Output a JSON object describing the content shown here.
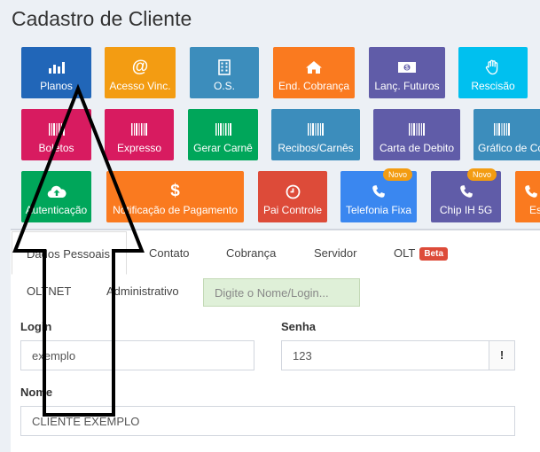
{
  "page": {
    "title": "Cadastro de Cliente"
  },
  "tiles_row1": [
    {
      "label": "Planos",
      "icon": "bar-chart-icon",
      "color": "#2166b8"
    },
    {
      "label": "Acesso Vinc.",
      "icon": "at-icon",
      "color": "#f39c12"
    },
    {
      "label": "O.S.",
      "icon": "building-icon",
      "color": "#3c8dbc"
    },
    {
      "label": "End. Cobrança",
      "icon": "home-icon",
      "color": "#fa7a1f"
    },
    {
      "label": "Lanç. Futuros",
      "icon": "money-icon",
      "color": "#605ca8"
    },
    {
      "label": "Rescisão",
      "icon": "hand-icon",
      "color": "#00c0ef"
    }
  ],
  "tiles_row2": [
    {
      "label": "Boletos",
      "icon": "barcode-icon",
      "color": "#d81b60"
    },
    {
      "label": "Expresso",
      "icon": "barcode-icon",
      "color": "#d81b60"
    },
    {
      "label": "Gerar Carnê",
      "icon": "barcode-icon",
      "color": "#00a65a"
    },
    {
      "label": "Recibos/Carnês",
      "icon": "barcode-icon",
      "color": "#3c8dbc"
    },
    {
      "label": "Carta de Debito",
      "icon": "barcode-icon",
      "color": "#605ca8"
    },
    {
      "label": "Gráfico de Co",
      "icon": "barcode-icon",
      "color": "#3c8dbc"
    }
  ],
  "tiles_row3": [
    {
      "label": "Autenticação",
      "icon": "cloud-upload-icon",
      "color": "#00a65a"
    },
    {
      "label": "Notificação de Pagamento",
      "icon": "dollar-icon",
      "color": "#fa7a1f"
    },
    {
      "label": "Pai Controle",
      "icon": "clock-icon",
      "color": "#dd4b39"
    },
    {
      "label": "Telefonia Fixa",
      "icon": "phone-icon",
      "color": "#3a87f0",
      "badge": "Novo"
    },
    {
      "label": "Chip IH 5G",
      "icon": "phone-icon",
      "color": "#605ca8",
      "badge": "Novo"
    },
    {
      "label": "Es",
      "icon": "phone-icon",
      "color": "#fa7a1f"
    }
  ],
  "tabs": {
    "dados_pessoais": "Dados Pessoais",
    "contato": "Contato",
    "cobranca": "Cobrança",
    "servidor": "Servidor",
    "olt": "OLT",
    "olt_badge": "Beta",
    "oltnet": "OLTNET",
    "administrativo": "Administrativo"
  },
  "search": {
    "placeholder": "Digite o Nome/Login..."
  },
  "form": {
    "login_label": "Login",
    "login_value": "exemplo",
    "senha_label": "Senha",
    "senha_value": "123",
    "senha_addon": "!",
    "nome_label": "Nome",
    "nome_value": "CLIENTE EXEMPLO"
  }
}
